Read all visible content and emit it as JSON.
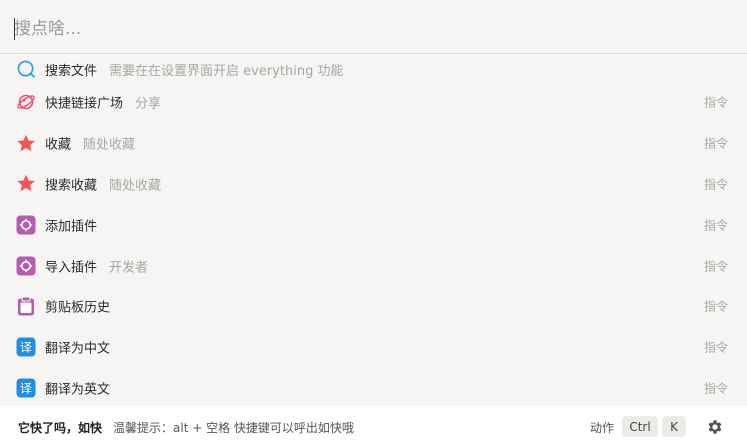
{
  "search": {
    "placeholder": "搜点啥..."
  },
  "items": [
    {
      "label": "搜索文件",
      "sub": "需要在在设置界面开启 everything 功能",
      "cmd": "",
      "icon": "search-circle-icon"
    },
    {
      "label": "快捷链接广场",
      "sub": "分享",
      "cmd": "指令",
      "icon": "planet-icon"
    },
    {
      "label": "收藏",
      "sub": "随处收藏",
      "cmd": "指令",
      "icon": "star-icon"
    },
    {
      "label": "搜索收藏",
      "sub": "随处收藏",
      "cmd": "指令",
      "icon": "star-icon"
    },
    {
      "label": "添加插件",
      "sub": "",
      "cmd": "指令",
      "icon": "plugin-icon"
    },
    {
      "label": "导入插件",
      "sub": "开发者",
      "cmd": "指令",
      "icon": "plugin-icon"
    },
    {
      "label": "剪贴板历史",
      "sub": "",
      "cmd": "指令",
      "icon": "clipboard-icon"
    },
    {
      "label": "翻译为中文",
      "sub": "",
      "cmd": "指令",
      "icon": "translate-icon"
    },
    {
      "label": "翻译为英文",
      "sub": "",
      "cmd": "指令",
      "icon": "translate-icon"
    }
  ],
  "footer": {
    "brand": "它快了吗，如快",
    "tip": "温馨提示：alt + 空格 快捷键可以呼出如快哦",
    "action_label": "动作",
    "key_ctrl": "Ctrl",
    "key_k": "K",
    "settings_icon": "gear-icon"
  },
  "colors": {
    "background": "#f6f5f3",
    "star": "#f25757",
    "plugin": "#b65bb1",
    "translate": "#1f8ee6",
    "search_icon": "#2aa3d6",
    "planet": "#ea4e6e"
  }
}
